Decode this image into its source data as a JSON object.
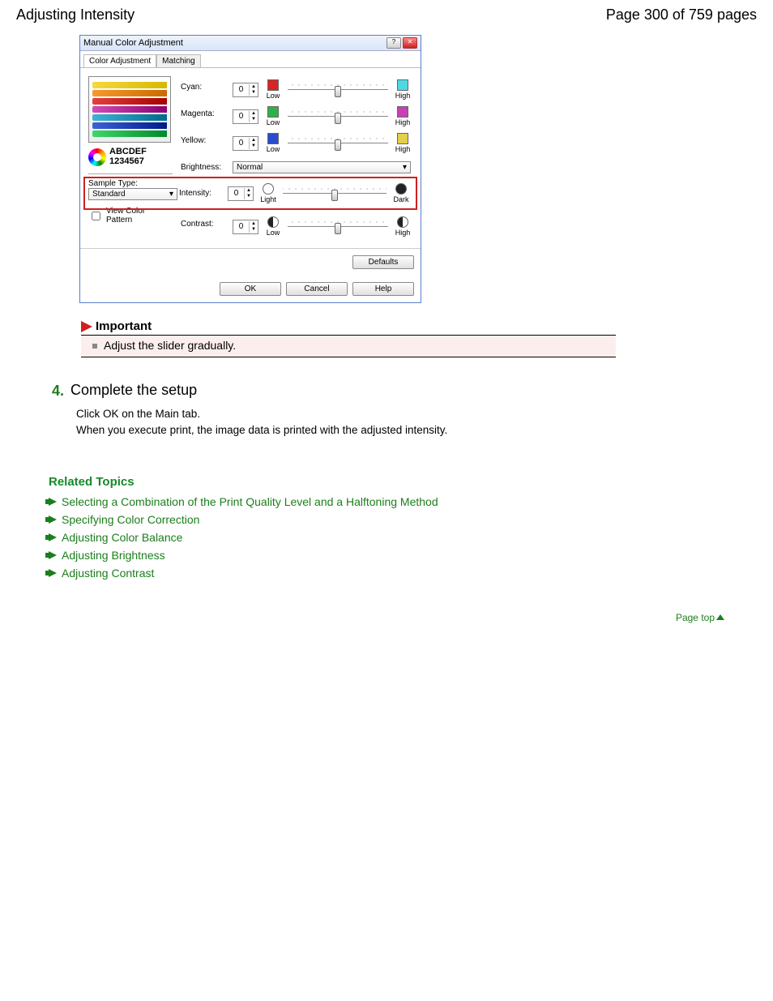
{
  "header": {
    "title": "Adjusting Intensity",
    "page_info": "Page 300 of 759 pages"
  },
  "dialog": {
    "title": "Manual Color Adjustment",
    "tabs": {
      "t1": "Color Adjustment",
      "t2": "Matching"
    },
    "sample_l1": "ABCDEF",
    "sample_l2": "1234567",
    "sample_type_label": "Sample Type:",
    "sample_type_value": "Standard",
    "view_pattern_label": "View Color Pattern",
    "labels": {
      "cyan": "Cyan:",
      "magenta": "Magenta:",
      "yellow": "Yellow:",
      "brightness": "Brightness:",
      "intensity": "Intensity:",
      "contrast": "Contrast:"
    },
    "values": {
      "cyan": "0",
      "magenta": "0",
      "yellow": "0",
      "intensity": "0",
      "contrast": "0",
      "brightness": "Normal"
    },
    "ends": {
      "low": "Low",
      "high": "High",
      "light": "Light",
      "dark": "Dark"
    },
    "buttons": {
      "defaults": "Defaults",
      "ok": "OK",
      "cancel": "Cancel",
      "help": "Help"
    }
  },
  "important": {
    "heading": "Important",
    "text": "Adjust the slider gradually."
  },
  "step": {
    "num": "4.",
    "title": "Complete the setup",
    "body1": "Click OK on the Main tab.",
    "body2": "When you execute print, the image data is printed with the adjusted intensity."
  },
  "related": {
    "heading": "Related Topics",
    "links": {
      "l1": "Selecting a Combination of the Print Quality Level and a Halftoning Method",
      "l2": "Specifying Color Correction",
      "l3": "Adjusting Color Balance",
      "l4": "Adjusting Brightness",
      "l5": "Adjusting Contrast"
    }
  },
  "page_top": "Page top"
}
